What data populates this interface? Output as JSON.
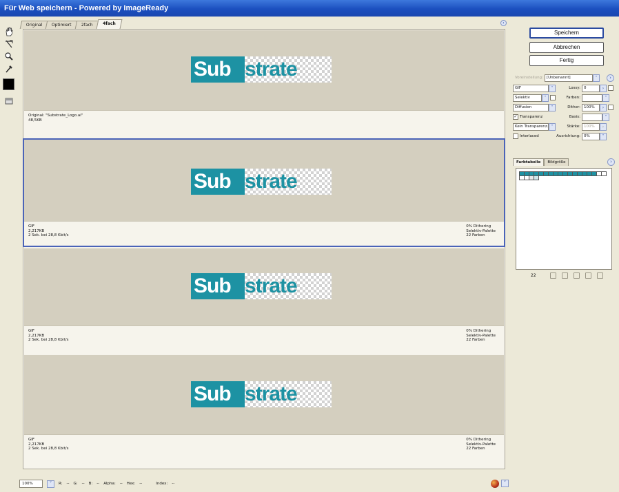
{
  "window": {
    "title": "Für Web speichern - Powered by ImageReady"
  },
  "tabs": [
    {
      "label": "Original"
    },
    {
      "label": "Optimiert"
    },
    {
      "label": "2fach"
    },
    {
      "label": "4fach",
      "active": true
    }
  ],
  "logo": {
    "part1": "Sub",
    "part2": "strate"
  },
  "panes": [
    {
      "line1": "Original: \"Substrate_Logo.ai\"",
      "line2": "48,5KB",
      "line3": "",
      "r1": "",
      "r2": "",
      "r3": ""
    },
    {
      "line1": "GIF",
      "line2": "2,217KB",
      "line3": "2 Sek. bei 28,8 Kbit/s",
      "r1": "0% Dithering",
      "r2": "Selektiv-Palette",
      "r3": "22  Farben",
      "selected": true
    },
    {
      "line1": "GIF",
      "line2": "2,217KB",
      "line3": "2 Sek. bei 28,8 Kbit/s",
      "r1": "0% Dithering",
      "r2": "Selektiv-Palette",
      "r3": "22  Farben"
    },
    {
      "line1": "GIF",
      "line2": "2,217KB",
      "line3": "2 Sek. bei 28,8 Kbit/s",
      "r1": "0% Dithering",
      "r2": "Selektiv-Palette",
      "r3": "22  Farben"
    }
  ],
  "tools": [
    "hand-tool-icon",
    "slice-select-icon",
    "zoom-icon",
    "eyedropper-icon",
    "color-swatch",
    "toggle-slices-icon"
  ],
  "buttons": {
    "save": "Speichern",
    "cancel": "Abbrechen",
    "done": "Fertig"
  },
  "settings": {
    "preset_label": "Voreinstellung:",
    "preset_value": "[Unbenannt]",
    "format": "GIF",
    "lossy_label": "Lossy:",
    "lossy_value": "0",
    "reduction": "Selektiv",
    "colors_label": "Farben:",
    "colors_value": "",
    "dither_algo": "Diffusion",
    "dither_label": "Dither:",
    "dither_value": "100%",
    "transparency_label": "Transparenz",
    "matte_label": "Basis:",
    "matte_value": "",
    "trans_dither": "Kein Transparenz...",
    "amount_label": "Stärke:",
    "amount_value": "100%",
    "interlaced_label": "Interlaced",
    "websnap_label": "Ausrichtung:",
    "websnap_value": "0%"
  },
  "palette": {
    "tab_color": "Farbtabelle",
    "tab_size": "Bildgröße",
    "count": "22",
    "swatches": [
      "#1d92a3",
      "#1d92a3",
      "#1d92a3",
      "#1d92a3",
      "#1d92a3",
      "#1d92a3",
      "#1d92a3",
      "#1d92a3",
      "#1d92a3",
      "#1d92a3",
      "#1d92a3",
      "#1d92a3",
      "#1d92a3",
      "#1d92a3",
      "#1d92a3",
      "#1d92a3",
      "#ffffff",
      "#ffffff",
      "#ffffff",
      "#ffffff",
      "#e8e8e8",
      "#cfe7ea"
    ]
  },
  "status": {
    "zoom": "100%",
    "r": "R:",
    "r_val": "--",
    "g": "G:",
    "g_val": "--",
    "b": "B:",
    "b_val": "--",
    "alpha": "Alpha:",
    "alpha_val": "--",
    "hex": "Hex:",
    "hex_val": "--",
    "index": "Index:",
    "index_val": "--"
  },
  "colors": {
    "accent": "#1d92a3",
    "titlebar": "#1b4fbf",
    "selection": "#4a63b8"
  }
}
